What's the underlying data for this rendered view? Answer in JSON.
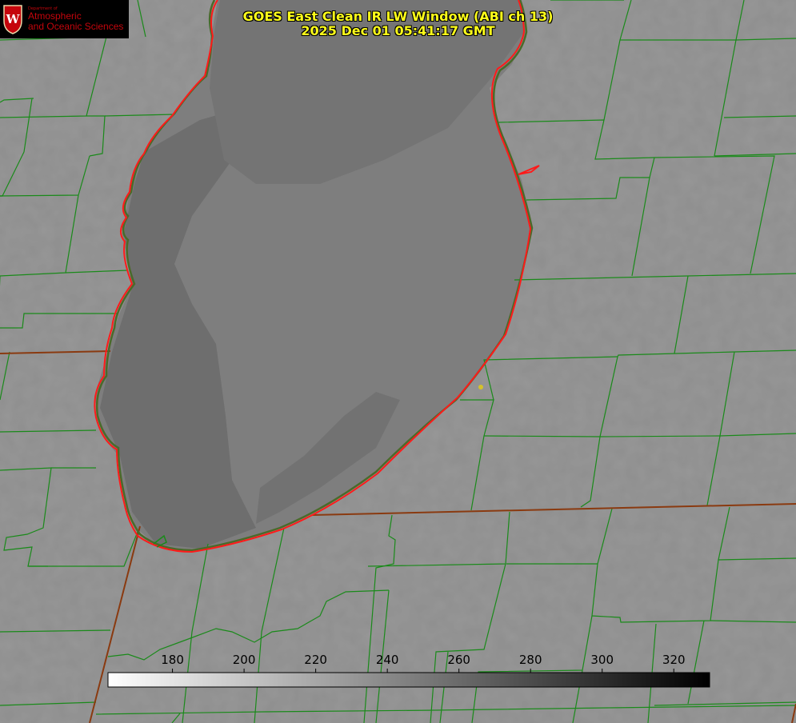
{
  "header": {
    "title_line1": "GOES East Clean IR LW Window (ABI ch 13)",
    "title_line2": "2025 Dec 01 05:41:17 GMT"
  },
  "logo": {
    "dept_small": "Department of",
    "line1": "Atmospheric",
    "line2": "and Oceanic Sciences",
    "brand_color": "#c5050c",
    "seal_letter": "W"
  },
  "colorbar": {
    "min": 162,
    "max": 330,
    "ticks": [
      180,
      200,
      220,
      240,
      260,
      280,
      300,
      320
    ],
    "color_low": "#ffffff",
    "color_high": "#000000"
  },
  "colors": {
    "title": "#ffff1a",
    "county_lines": "#1a8a1a",
    "state_lines": "#8a3a10",
    "lake_outline": "#ff1a1a",
    "station_marker": "#d4c22a"
  }
}
